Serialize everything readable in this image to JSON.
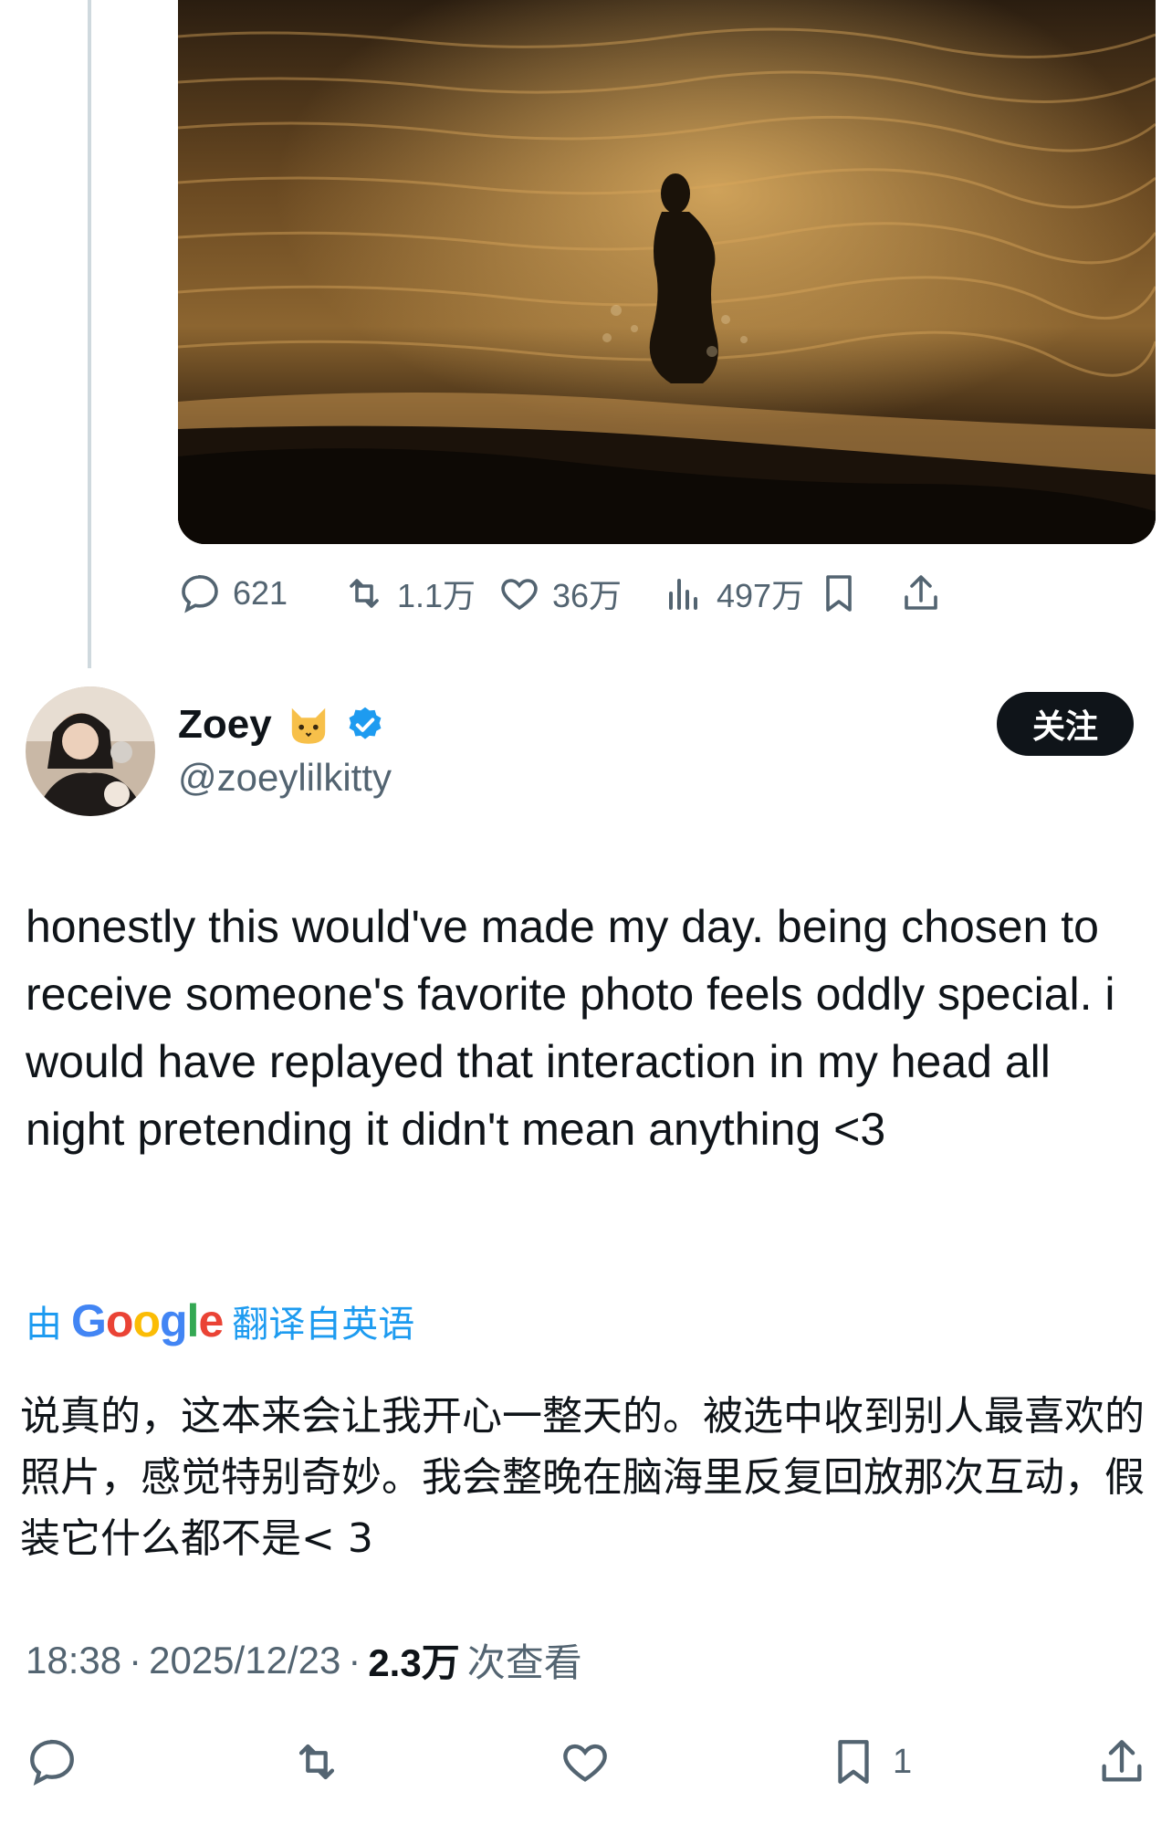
{
  "tweet_media": {
    "alt": "photo"
  },
  "top_actions": {
    "replies": "621",
    "retweets": "1.1万",
    "likes": "36万",
    "views": "497万"
  },
  "author": {
    "name": "Zoey",
    "emoji": "cat-face-emoji",
    "handle": "@zoeylilkitty",
    "follow_label": "关注"
  },
  "tweet": {
    "text": "honestly this would've made my day. being chosen to receive someone's favorite photo feels oddly special. i would have replayed that interaction in my head all night pretending it didn't mean anything <3"
  },
  "translation": {
    "by": "由",
    "provider": "Google",
    "from": "翻译自英语",
    "text": "说真的，这本来会让我开心一整天的。被选中收到别人最喜欢的照片，感觉特别奇妙。我会整晚在脑海里反复回放那次互动，假装它什么都不是< 3"
  },
  "meta": {
    "time": "18:38",
    "sep1": "·",
    "date": "2025/12/23",
    "sep2": "·",
    "views": "2.3万",
    "views_label": "次查看"
  },
  "bottom_actions": {
    "bookmarks": "1"
  },
  "colors": {
    "accent": "#1d9bf0",
    "text": "#0f1419",
    "muted": "#536471",
    "verified": "#1d9bf0"
  }
}
